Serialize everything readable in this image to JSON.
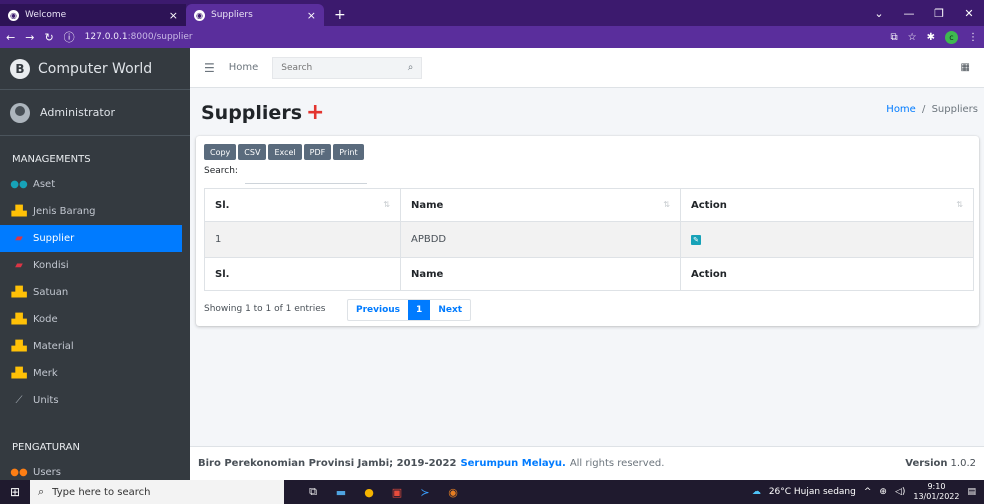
{
  "browser": {
    "tabs": [
      {
        "title": "Welcome",
        "active": false
      },
      {
        "title": "Suppliers",
        "active": true
      }
    ],
    "url_host": "127.0.0.1",
    "url_rest": ":8000/supplier",
    "profile_initial": "c"
  },
  "sidebar": {
    "brand": "Computer World",
    "user": "Administrator",
    "section_managements": "MANAGEMENTS",
    "items": [
      {
        "label": "Aset",
        "icon": "people-icon"
      },
      {
        "label": "Jenis Barang",
        "icon": "sitemap-icon"
      },
      {
        "label": "Supplier",
        "icon": "truck-icon"
      },
      {
        "label": "Kondisi",
        "icon": "truck-icon"
      },
      {
        "label": "Satuan",
        "icon": "sitemap-icon"
      },
      {
        "label": "Kode",
        "icon": "sitemap-icon"
      },
      {
        "label": "Material",
        "icon": "sitemap-icon"
      },
      {
        "label": "Merk",
        "icon": "sitemap-icon"
      },
      {
        "label": "Units",
        "icon": "ruler-icon"
      }
    ],
    "active_item": "Supplier",
    "section_pengaturan": "PENGATURAN",
    "users_label": "Users"
  },
  "topnav": {
    "home": "Home",
    "search_placeholder": "Search"
  },
  "content": {
    "title": "Suppliers",
    "breadcrumb_home": "Home",
    "breadcrumb_sep": "/",
    "breadcrumb_current": "Suppliers"
  },
  "table": {
    "buttons": [
      "Copy",
      "CSV",
      "Excel",
      "PDF",
      "Print"
    ],
    "search_label": "Search:",
    "columns": [
      "Sl.",
      "Name",
      "Action"
    ],
    "rows": [
      {
        "sl": "1",
        "name": "APBDD"
      }
    ],
    "info": "Showing 1 to 1 of 1 entries",
    "pager": {
      "prev": "Previous",
      "current": "1",
      "next": "Next"
    }
  },
  "footer": {
    "text": "Biro Perekonomian Provinsi Jambi; 2019-2022",
    "link": "Serumpun Melayu.",
    "rights": "All rights reserved.",
    "version_label": "Version",
    "version_number": "1.0.2"
  },
  "taskbar": {
    "search_placeholder": "Type here to search",
    "weather": "26°C  Hujan sedang",
    "time": "9:10",
    "date": "13/01/2022"
  }
}
